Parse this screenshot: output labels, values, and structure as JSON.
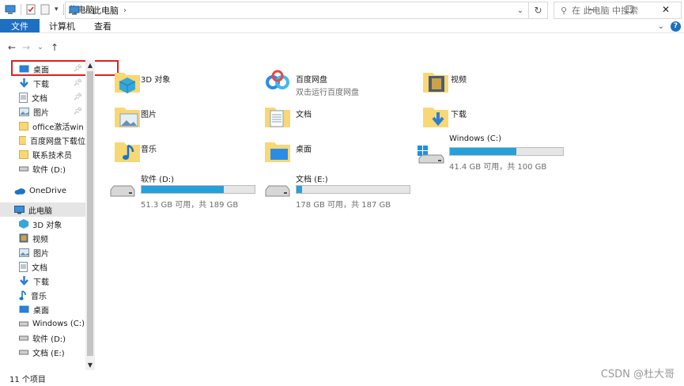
{
  "title": "此电脑",
  "ribbon": {
    "tabs": [
      "文件",
      "计算机",
      "查看"
    ]
  },
  "address": {
    "path": "此电脑"
  },
  "search": {
    "placeholder": "在 此电脑 中搜索"
  },
  "sidebar": {
    "quick": [
      "桌面",
      "下载",
      "文档",
      "图片",
      "office激活win",
      "百度网盘下载位",
      "联系技术员",
      "软件 (D:)"
    ],
    "onedrive": "OneDrive",
    "thispc": "此电脑",
    "pc_items": [
      "3D 对象",
      "视频",
      "图片",
      "文档",
      "下载",
      "音乐",
      "桌面",
      "Windows (C:)",
      "软件 (D:)",
      "文档 (E:)"
    ]
  },
  "folders": [
    {
      "name": "3D 对象",
      "sub": ""
    },
    {
      "name": "百度网盘",
      "sub": "双击运行百度网盘"
    },
    {
      "name": "视频",
      "sub": ""
    },
    {
      "name": "图片",
      "sub": ""
    },
    {
      "name": "文档",
      "sub": ""
    },
    {
      "name": "下载",
      "sub": ""
    },
    {
      "name": "音乐",
      "sub": ""
    },
    {
      "name": "桌面",
      "sub": ""
    }
  ],
  "drives": [
    {
      "name": "Windows (C:)",
      "info": "41.4 GB 可用，共 100 GB",
      "used_fraction": 0.586
    },
    {
      "name": "软件 (D:)",
      "info": "51.3 GB 可用，共 189 GB",
      "used_fraction": 0.729
    },
    {
      "name": "文档 (E:)",
      "info": "178 GB 可用，共 187 GB",
      "used_fraction": 0.048
    }
  ],
  "status": {
    "count": "11 个项目"
  },
  "watermark": "CSDN @杜大哥",
  "colors": {
    "accent": "#1e6fc1",
    "drive_bar": "#26a0da",
    "highlight": "#e02020"
  }
}
